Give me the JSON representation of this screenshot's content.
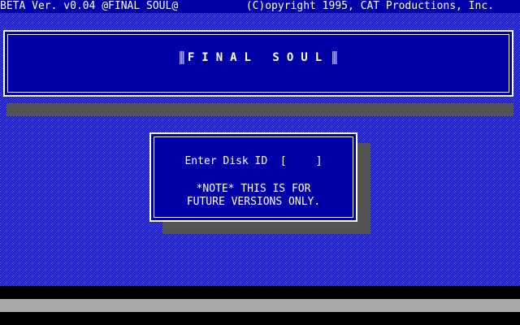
{
  "header": {
    "version": "BETA Ver. v0.04 @FINAL SOUL@",
    "copyright": "(C)opyright 1995, CAT Productions, Inc."
  },
  "title": {
    "text": "FINAL SOUL"
  },
  "dialog": {
    "prompt": "Enter Disk ID",
    "open_bracket": "[",
    "close_bracket": "]",
    "disk_id_value": "",
    "note_line1": "*NOTE* THIS IS FOR",
    "note_line2": "FUTURE VERSIONS ONLY."
  },
  "colors": {
    "background": "#0000a8",
    "dither": "#5454fc",
    "shadow": "#545454",
    "text": "#ffffff"
  }
}
